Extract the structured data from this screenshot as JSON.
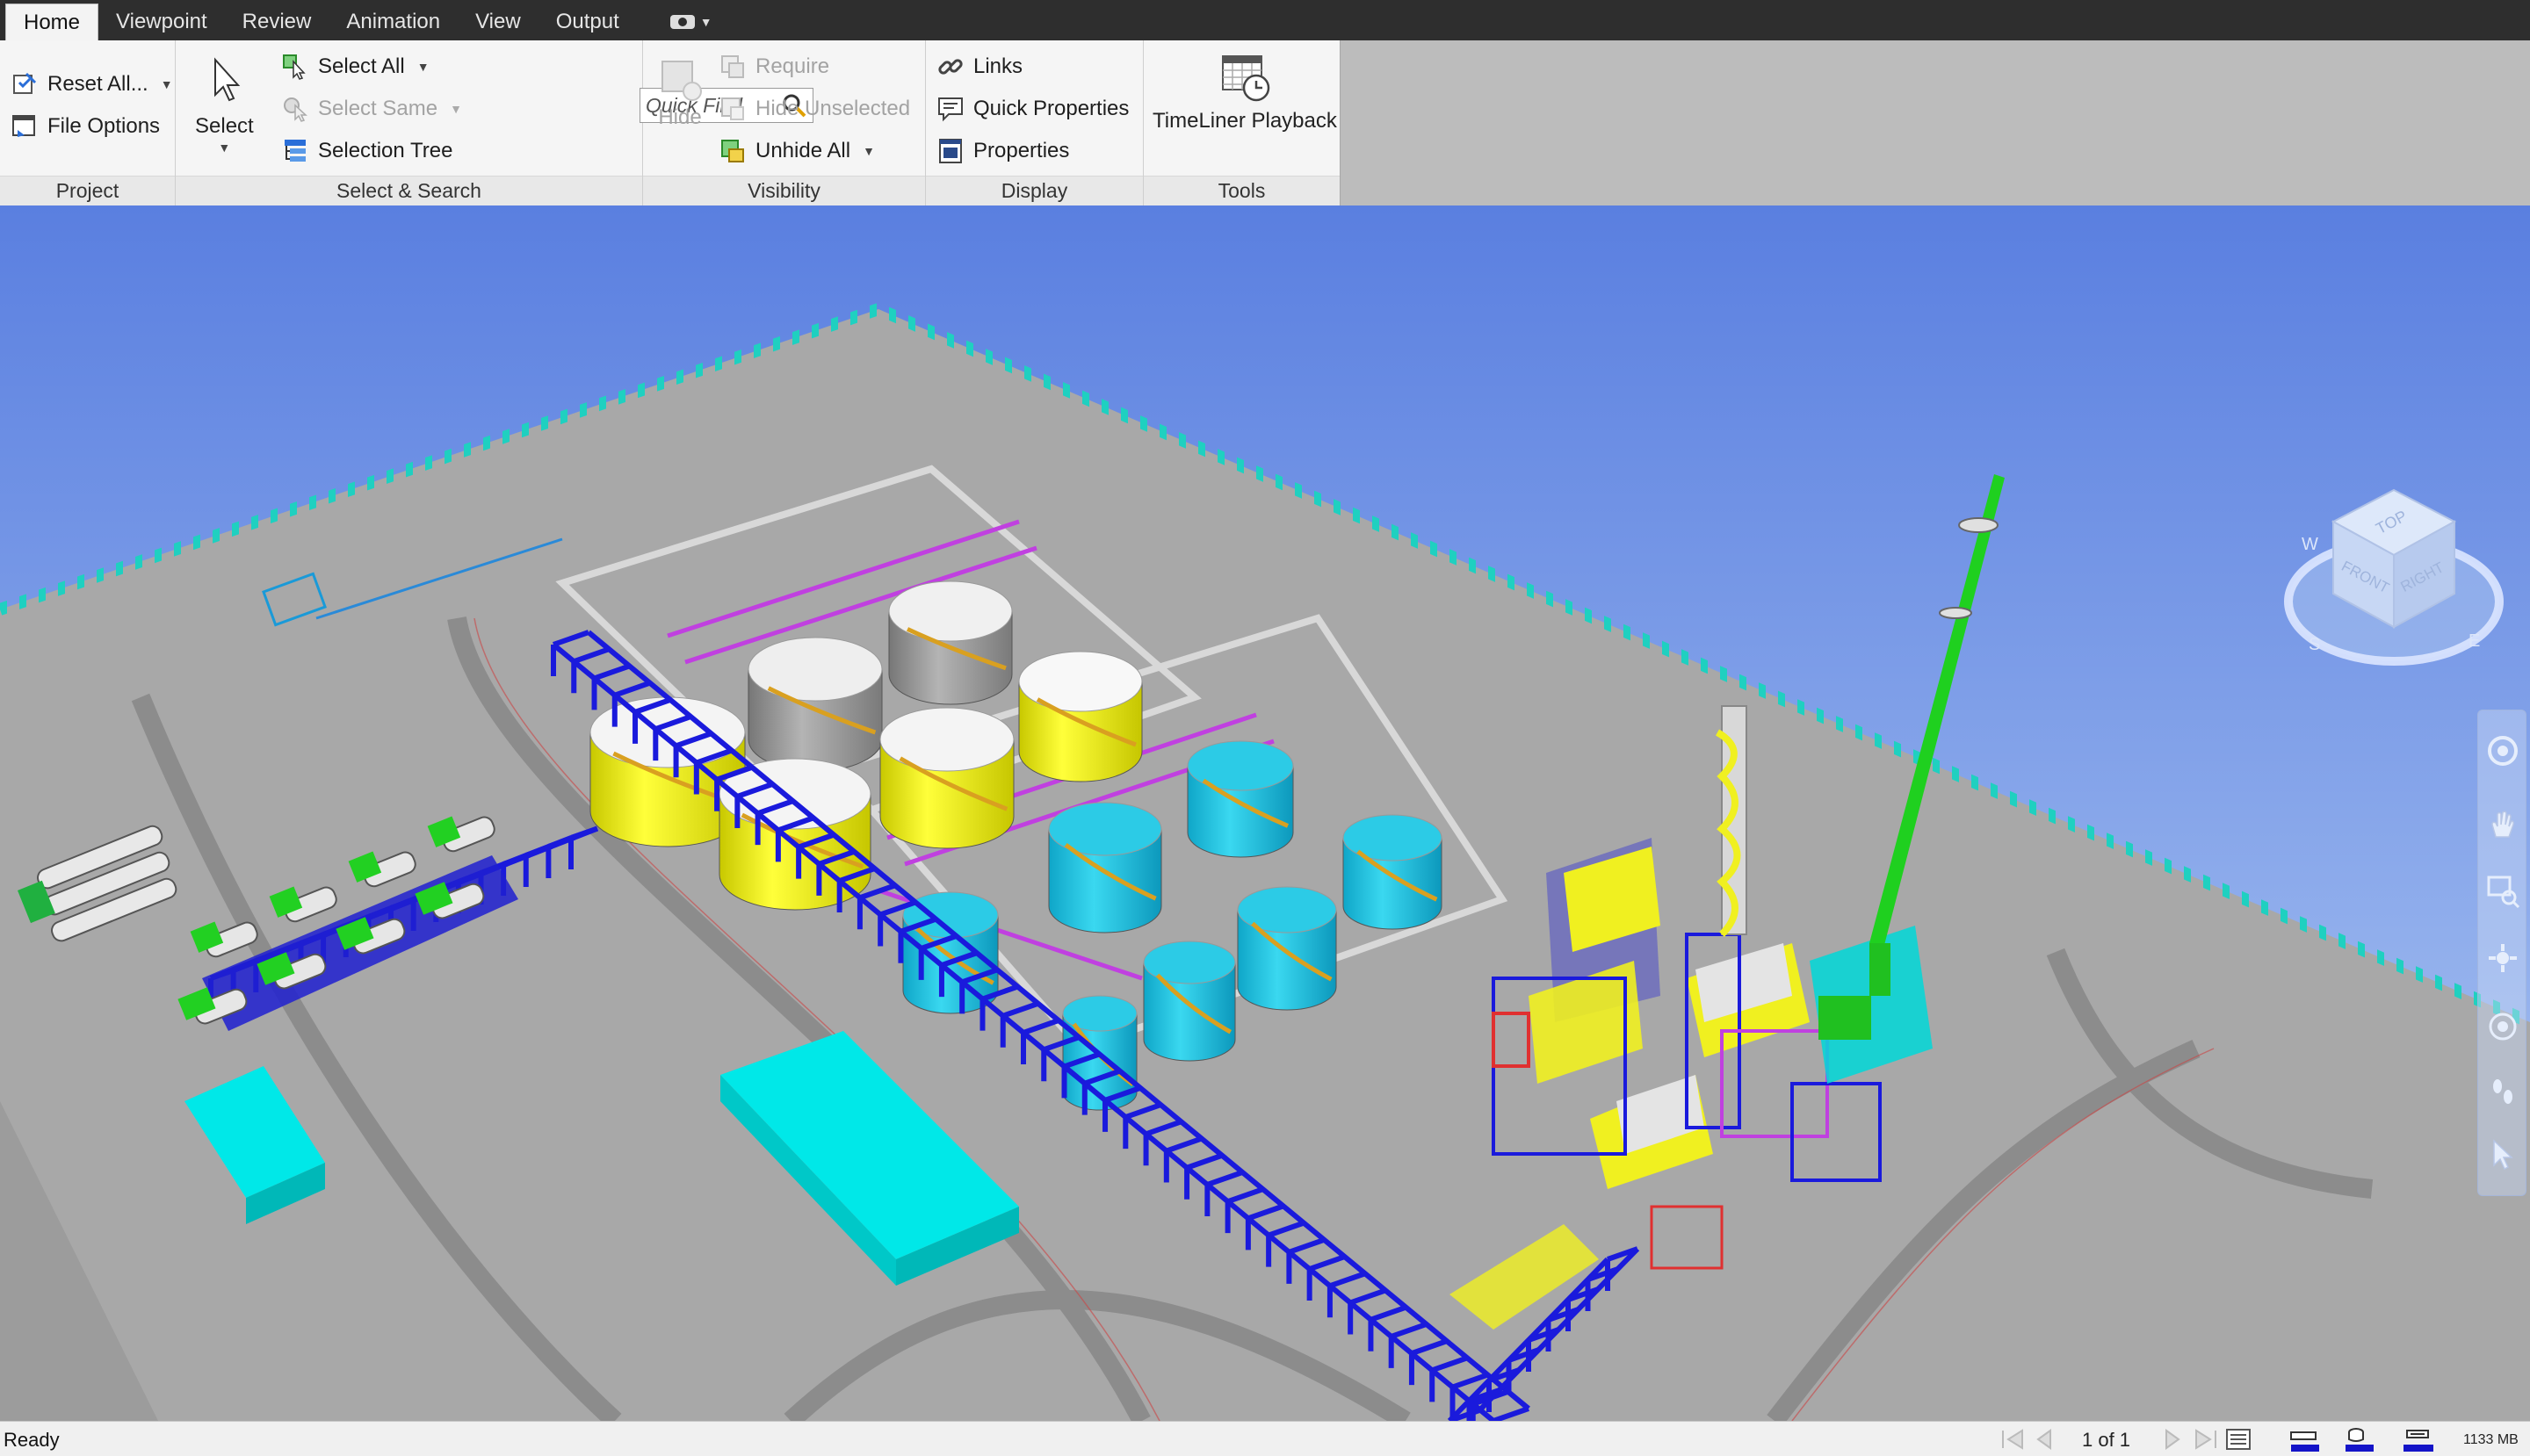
{
  "tabs": [
    {
      "label": "Home"
    },
    {
      "label": "Viewpoint"
    },
    {
      "label": "Review"
    },
    {
      "label": "Animation"
    },
    {
      "label": "View"
    },
    {
      "label": "Output"
    }
  ],
  "ribbon": {
    "project": {
      "reset_all": "Reset All...",
      "file_options": "File Options",
      "footer": "Project"
    },
    "select_search": {
      "select": "Select",
      "select_all": "Select All",
      "select_same": "Select Same",
      "selection_tree": "Selection Tree",
      "quick_find_placeholder": "Quick Find",
      "footer": "Select & Search"
    },
    "visibility": {
      "hide": "Hide",
      "require": "Require",
      "hide_unselected": "Hide Unselected",
      "unhide_all": "Unhide All",
      "footer": "Visibility"
    },
    "display": {
      "links": "Links",
      "quick_properties": "Quick Properties",
      "properties": "Properties",
      "footer": "Display"
    },
    "tools": {
      "timeliner_playback": "TimeLiner Playback",
      "footer": "Tools"
    }
  },
  "viewcube": {
    "top": "TOP",
    "front": "FRONT",
    "right": "RIGHT",
    "compass": [
      "W",
      "S",
      "E"
    ]
  },
  "statusbar": {
    "status": "Ready",
    "page": "1 of 1",
    "memory": "1133 MB"
  },
  "colors": {
    "sky_top": "#5a7fe0",
    "sky_bottom": "#a8c4f2",
    "ground": "#a6a6a6",
    "tank_yellow": "#f2f21a",
    "tank_cyan": "#1fc4e0",
    "tank_gray": "#9a9a9a",
    "pipe_blue": "#1818d8",
    "equipment_cyan": "#00e5e5"
  }
}
